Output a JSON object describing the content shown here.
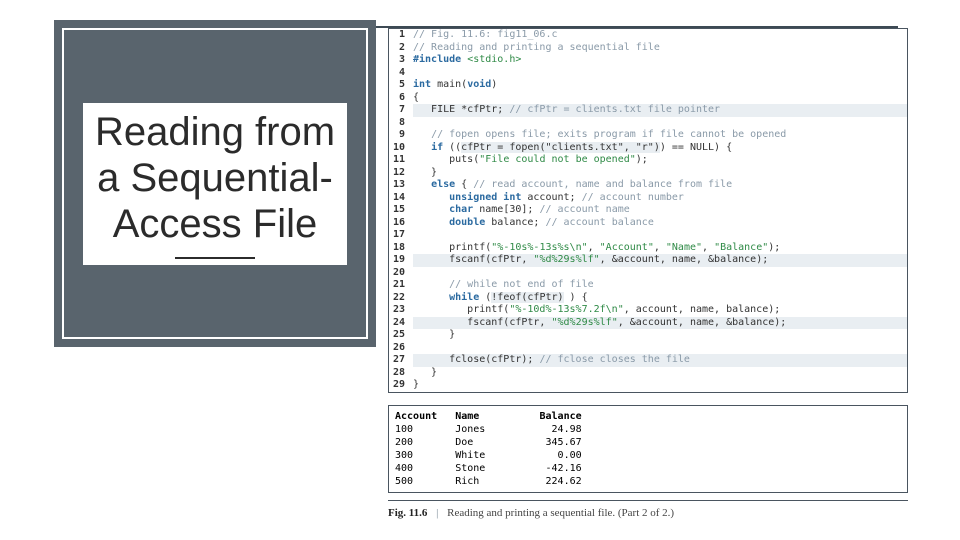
{
  "title": {
    "line1": "Reading from",
    "line2": "a Sequential-",
    "line3": "Access File"
  },
  "code": {
    "lines": [
      {
        "n": "1",
        "seg": [
          {
            "c": "cmt",
            "t": "// Fig. 11.6: fig11_06.c"
          }
        ]
      },
      {
        "n": "2",
        "seg": [
          {
            "c": "cmt",
            "t": "// Reading and printing a sequential file"
          }
        ]
      },
      {
        "n": "3",
        "seg": [
          {
            "c": "pp",
            "t": "#include "
          },
          {
            "c": "str",
            "t": "<stdio.h>"
          }
        ]
      },
      {
        "n": "4",
        "seg": [
          {
            "c": "",
            "t": ""
          }
        ]
      },
      {
        "n": "5",
        "seg": [
          {
            "c": "kw",
            "t": "int"
          },
          {
            "c": "",
            "t": " main("
          },
          {
            "c": "kw",
            "t": "void"
          },
          {
            "c": "",
            "t": ")"
          }
        ]
      },
      {
        "n": "6",
        "seg": [
          {
            "c": "",
            "t": "{"
          }
        ]
      },
      {
        "n": "7",
        "hl": true,
        "seg": [
          {
            "c": "",
            "t": "   FILE *cfPtr;"
          },
          {
            "c": "cmt",
            "t": " // cfPtr = clients.txt file pointer"
          }
        ]
      },
      {
        "n": "8",
        "seg": [
          {
            "c": "",
            "t": ""
          }
        ]
      },
      {
        "n": "9",
        "seg": [
          {
            "c": "",
            "t": "   "
          },
          {
            "c": "cmt",
            "t": "// fopen opens file; exits program if file cannot be opened"
          }
        ]
      },
      {
        "n": "10",
        "seg": [
          {
            "c": "",
            "t": "   "
          },
          {
            "c": "kw",
            "t": "if"
          },
          {
            "c": "",
            "t": " (("
          },
          {
            "c": "hl",
            "t": "cfPtr = fopen(\"clients.txt\", \"r\")"
          },
          {
            "c": "",
            "t": ") == NULL) {"
          }
        ]
      },
      {
        "n": "11",
        "seg": [
          {
            "c": "",
            "t": "      puts("
          },
          {
            "c": "str",
            "t": "\"File could not be opened\""
          },
          {
            "c": "",
            "t": ");"
          }
        ]
      },
      {
        "n": "12",
        "seg": [
          {
            "c": "",
            "t": "   }"
          }
        ]
      },
      {
        "n": "13",
        "seg": [
          {
            "c": "",
            "t": "   "
          },
          {
            "c": "kw",
            "t": "else"
          },
          {
            "c": "",
            "t": " { "
          },
          {
            "c": "cmt",
            "t": "// read account, name and balance from file"
          }
        ]
      },
      {
        "n": "14",
        "seg": [
          {
            "c": "",
            "t": "      "
          },
          {
            "c": "kw",
            "t": "unsigned int"
          },
          {
            "c": "",
            "t": " account; "
          },
          {
            "c": "cmt",
            "t": "// account number"
          }
        ]
      },
      {
        "n": "15",
        "seg": [
          {
            "c": "",
            "t": "      "
          },
          {
            "c": "kw",
            "t": "char"
          },
          {
            "c": "",
            "t": " name[30]; "
          },
          {
            "c": "cmt",
            "t": "// account name"
          }
        ]
      },
      {
        "n": "16",
        "seg": [
          {
            "c": "",
            "t": "      "
          },
          {
            "c": "kw",
            "t": "double"
          },
          {
            "c": "",
            "t": " balance; "
          },
          {
            "c": "cmt",
            "t": "// account balance"
          }
        ]
      },
      {
        "n": "17",
        "seg": [
          {
            "c": "",
            "t": ""
          }
        ]
      },
      {
        "n": "18",
        "seg": [
          {
            "c": "",
            "t": "      printf("
          },
          {
            "c": "str",
            "t": "\"%-10s%-13s%s\\n\""
          },
          {
            "c": "",
            "t": ", "
          },
          {
            "c": "str",
            "t": "\"Account\""
          },
          {
            "c": "",
            "t": ", "
          },
          {
            "c": "str",
            "t": "\"Name\""
          },
          {
            "c": "",
            "t": ", "
          },
          {
            "c": "str",
            "t": "\"Balance\""
          },
          {
            "c": "",
            "t": ");"
          }
        ]
      },
      {
        "n": "19",
        "hl": true,
        "seg": [
          {
            "c": "",
            "t": "      fscanf(cfPtr, "
          },
          {
            "c": "str",
            "t": "\"%d%29s%lf\""
          },
          {
            "c": "",
            "t": ", &account, name, &balance);"
          }
        ]
      },
      {
        "n": "20",
        "seg": [
          {
            "c": "",
            "t": ""
          }
        ]
      },
      {
        "n": "21",
        "seg": [
          {
            "c": "",
            "t": "      "
          },
          {
            "c": "cmt",
            "t": "// while not end of file"
          }
        ]
      },
      {
        "n": "22",
        "seg": [
          {
            "c": "",
            "t": "      "
          },
          {
            "c": "kw",
            "t": "while"
          },
          {
            "c": "",
            "t": " ("
          },
          {
            "c": "hl",
            "t": "!feof(cfPtr)"
          },
          {
            "c": "",
            "t": " ) {"
          }
        ]
      },
      {
        "n": "23",
        "seg": [
          {
            "c": "",
            "t": "         printf("
          },
          {
            "c": "str",
            "t": "\"%-10d%-13s%7.2f\\n\""
          },
          {
            "c": "",
            "t": ", account, name, balance);"
          }
        ]
      },
      {
        "n": "24",
        "hl": true,
        "seg": [
          {
            "c": "",
            "t": "         fscanf(cfPtr, "
          },
          {
            "c": "str",
            "t": "\"%d%29s%lf\""
          },
          {
            "c": "",
            "t": ", &account, name, &balance);"
          }
        ]
      },
      {
        "n": "25",
        "seg": [
          {
            "c": "",
            "t": "      }"
          }
        ]
      },
      {
        "n": "26",
        "seg": [
          {
            "c": "",
            "t": ""
          }
        ]
      },
      {
        "n": "27",
        "hl": true,
        "seg": [
          {
            "c": "",
            "t": "      fclose(cfPtr); "
          },
          {
            "c": "cmt",
            "t": "// fclose closes the file"
          }
        ]
      },
      {
        "n": "28",
        "seg": [
          {
            "c": "",
            "t": "   }"
          }
        ]
      },
      {
        "n": "29",
        "seg": [
          {
            "c": "",
            "t": "}"
          }
        ]
      }
    ]
  },
  "output": {
    "header": [
      "Account",
      "Name",
      "Balance"
    ],
    "rows": [
      {
        "account": "100",
        "name": "Jones",
        "balance": "24.98"
      },
      {
        "account": "200",
        "name": "Doe",
        "balance": "345.67"
      },
      {
        "account": "300",
        "name": "White",
        "balance": "0.00"
      },
      {
        "account": "400",
        "name": "Stone",
        "balance": "-42.16"
      },
      {
        "account": "500",
        "name": "Rich",
        "balance": "224.62"
      }
    ]
  },
  "caption": {
    "fignum": "Fig. 11.6",
    "text": "Reading and printing a sequential file. (Part 2 of 2.)"
  }
}
